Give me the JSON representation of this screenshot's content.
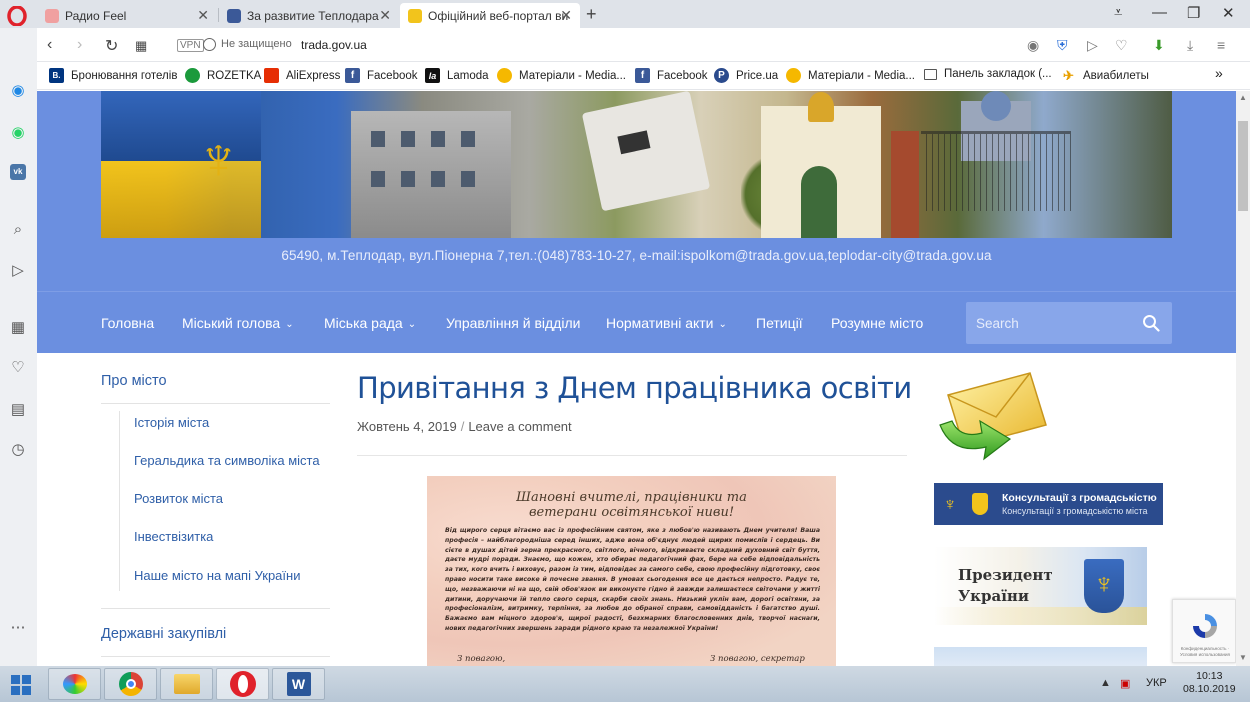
{
  "browser": {
    "tabs": [
      {
        "label": "Радио Feel",
        "active": false
      },
      {
        "label": "За развитие Теплодара",
        "active": false
      },
      {
        "label": "Офіційний веб-портал ви",
        "active": true
      }
    ],
    "new_tab_symbol": "+",
    "address": {
      "vpn_label": "VPN",
      "security_text": "Не защищено",
      "url": "trada.gov.ua"
    },
    "bookmarks": [
      {
        "label": "Бронювання готелів",
        "icon": "booking-icon",
        "color": "#003580",
        "glyph": "B."
      },
      {
        "label": "ROZETKA",
        "icon": "rozetka-icon",
        "color": "#1b9a3c",
        "glyph": ""
      },
      {
        "label": "AliExpress",
        "icon": "aliexpress-icon",
        "color": "#e62e04",
        "glyph": ""
      },
      {
        "label": "Facebook",
        "icon": "facebook-icon",
        "color": "#3b5998",
        "glyph": "f"
      },
      {
        "label": "Lamoda",
        "icon": "lamoda-icon",
        "color": "#111111",
        "glyph": "la"
      },
      {
        "label": "Матеріали - Media...",
        "icon": "media-icon",
        "color": "#f5b800",
        "glyph": ""
      },
      {
        "label": "Facebook",
        "icon": "facebook-icon",
        "color": "#3b5998",
        "glyph": "f"
      },
      {
        "label": "Price.ua",
        "icon": "price-icon",
        "color": "#2b4b8d",
        "glyph": "P"
      },
      {
        "label": "Матеріали - Media...",
        "icon": "media-icon",
        "color": "#f5b800",
        "glyph": ""
      },
      {
        "label": "Панель закладок (...",
        "icon": "folder-icon",
        "color": "#ffffff",
        "glyph": ""
      },
      {
        "label": "Авиабилеты",
        "icon": "plane-icon",
        "color": "#ffffff",
        "glyph": "✈"
      }
    ],
    "more_symbol": "»"
  },
  "site": {
    "address_line": "65490, м.Теплодар, вул.Піонерна 7,тел.:(048)783-10-27, e-mail:ispolkom@trada.gov.ua,teplodar-city@trada.gov.ua",
    "menu": [
      {
        "label": "Головна",
        "dropdown": false
      },
      {
        "label": "Міський голова",
        "dropdown": true
      },
      {
        "label": "Міська рада",
        "dropdown": true
      },
      {
        "label": "Управління й відділи",
        "dropdown": false
      },
      {
        "label": "Нормативні акти",
        "dropdown": true
      },
      {
        "label": "Петиції",
        "dropdown": false
      },
      {
        "label": "Розумне місто",
        "dropdown": false
      }
    ],
    "search_placeholder": "Search",
    "left_nav": {
      "title": "Про місто",
      "items": [
        "Історія міста",
        "Геральдика та символіка міста",
        "Розвиток міста",
        "Інвествізитка",
        "Наше місто на мапі України"
      ],
      "title2": "Державні закупівлі"
    },
    "post": {
      "title": "Привітання з Днем працівника освіти",
      "date": "Жовтень 4, 2019",
      "separator": "/",
      "comment_link": "Leave a comment",
      "letter": {
        "heading_line1": "Шановні вчителі, працівники та",
        "heading_line2": "ветерани освітянської ниви!",
        "body": "Від щирого серця вітаємо вас із професійним святом, яке з любов'ю називають Днем учителя! Ваша професія – найблагородніша серед інших, адже вона об'єднує людей щирих помислів і сердець. Ви сієте в душах дітей зерна прекрасного, світлого, вічного, відкриваєте складний духовний світ буття, даєте мудрі поради. Знаємо, що кожен, хто обирає педагогічний фах, бере на себе відповідальність за тих, кого вчить і виховує, разом із тим, відповідає за самого себе, свою професійну підготовку, своє право носити таке високе й почесне звання. В умовах сьогодення все це дається непросто. Радує те, що, незважаючи ні на що, свій обов'язок ви виконуєте гідно й завжди залишаєтеся світочами у житті дитини, доручаючи їй тепло свого серця, скарби своїх знань. Низький уклін вам, дорогі освітяни, за професіоналізм, витримку, терпіння, за любов до обраної справи, самовідданість і багатство душі. Бажаємо вам міцного здоров'я, щирої радості, безхмарних благословенних днів, творчої наснаги, нових педагогічних звершень заради рідного краю та незалежної України!",
        "sign_left": "З повагою,",
        "sign_right": "З повагою, секретар"
      }
    },
    "sidebar_right": {
      "consult_line1": "Консультації з громадськістю",
      "consult_line2": "Консультації з громадськістю міста",
      "president_line1": "Президент",
      "president_line2": "України"
    },
    "recaptcha_text": "Конфиденциальность · Условия использования"
  },
  "taskbar": {
    "language": "УКР",
    "time": "10:13",
    "date": "08.10.2019"
  }
}
